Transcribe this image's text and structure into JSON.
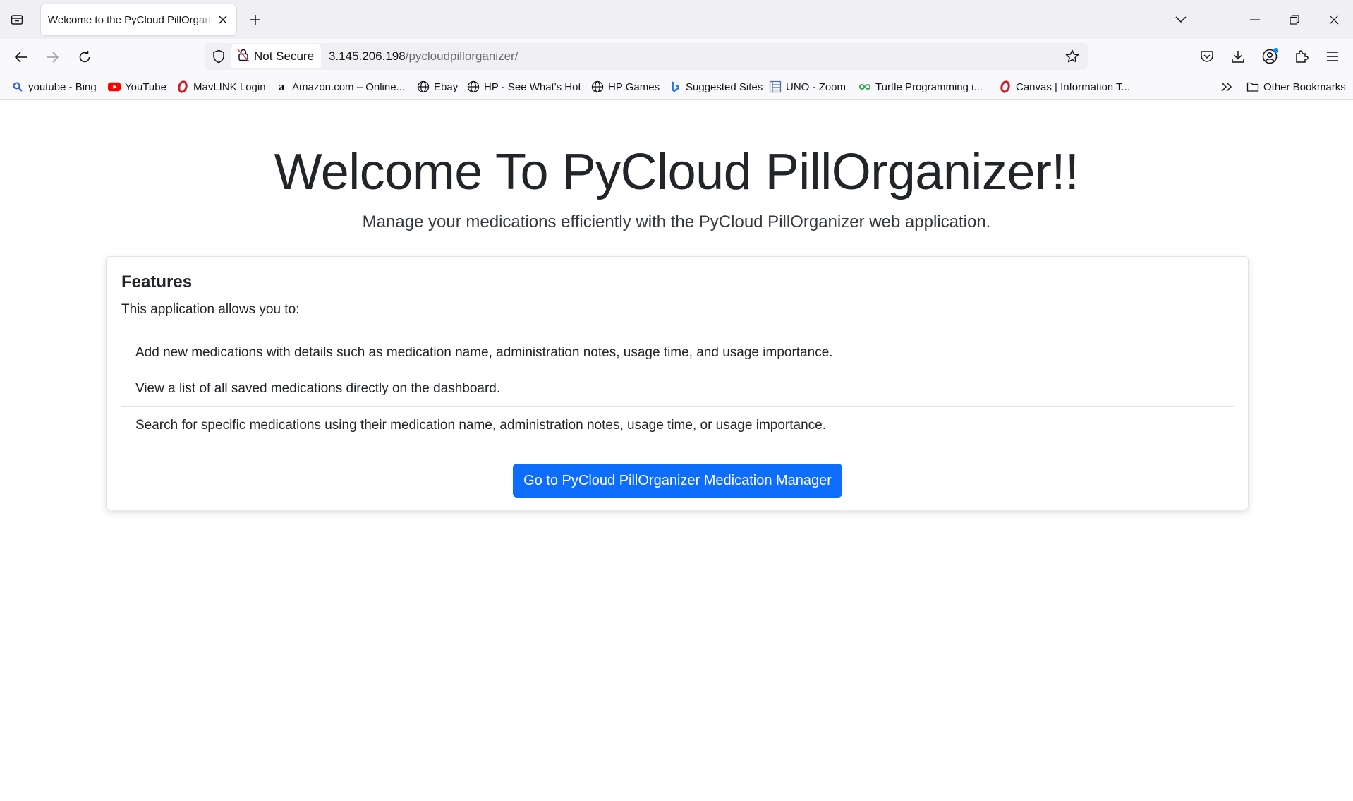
{
  "browser": {
    "tab_title": "Welcome to the PyCloud PillOrganizer",
    "security_label": "Not Secure",
    "url_host": "3.145.206.198",
    "url_path": "/pycloudpillorganizer/",
    "bookmarks": [
      {
        "label": "youtube - Bing",
        "icon": "search-icon"
      },
      {
        "label": "YouTube",
        "icon": "youtube-icon"
      },
      {
        "label": "MavLINK Login",
        "icon": "opera-icon"
      },
      {
        "label": "Amazon.com – Online...",
        "icon": "amazon-icon"
      },
      {
        "label": "Ebay",
        "icon": "globe-icon"
      },
      {
        "label": "HP - See What's Hot",
        "icon": "globe-icon"
      },
      {
        "label": "HP Games",
        "icon": "globe-icon"
      },
      {
        "label": "Suggested Sites",
        "icon": "bing-icon"
      },
      {
        "label": "UNO - Zoom",
        "icon": "document-icon"
      },
      {
        "label": "Turtle Programming i...",
        "icon": "turtle-icon"
      },
      {
        "label": "Canvas | Information T...",
        "icon": "opera-icon"
      }
    ],
    "other_bookmarks": "Other Bookmarks"
  },
  "hero": {
    "title": "Welcome To PyCloud PillOrganizer!!",
    "subtitle": "Manage your medications efficiently with the PyCloud PillOrganizer web application."
  },
  "card": {
    "title": "Features",
    "intro": "This application allows you to:",
    "features": [
      "Add new medications with details such as medication name, administration notes, usage time, and usage importance.",
      "View a list of all saved medications directly on the dashboard.",
      "Search for specific medications using their medication name, administration notes, usage time, or usage importance."
    ],
    "button_label": "Go to PyCloud PillOrganizer Medication Manager"
  },
  "colors": {
    "primary_button": "#0d6efd",
    "youtube_red": "#ff0000",
    "opera_red": "#cc1b2b",
    "profile_dot": "#0a84ff"
  }
}
